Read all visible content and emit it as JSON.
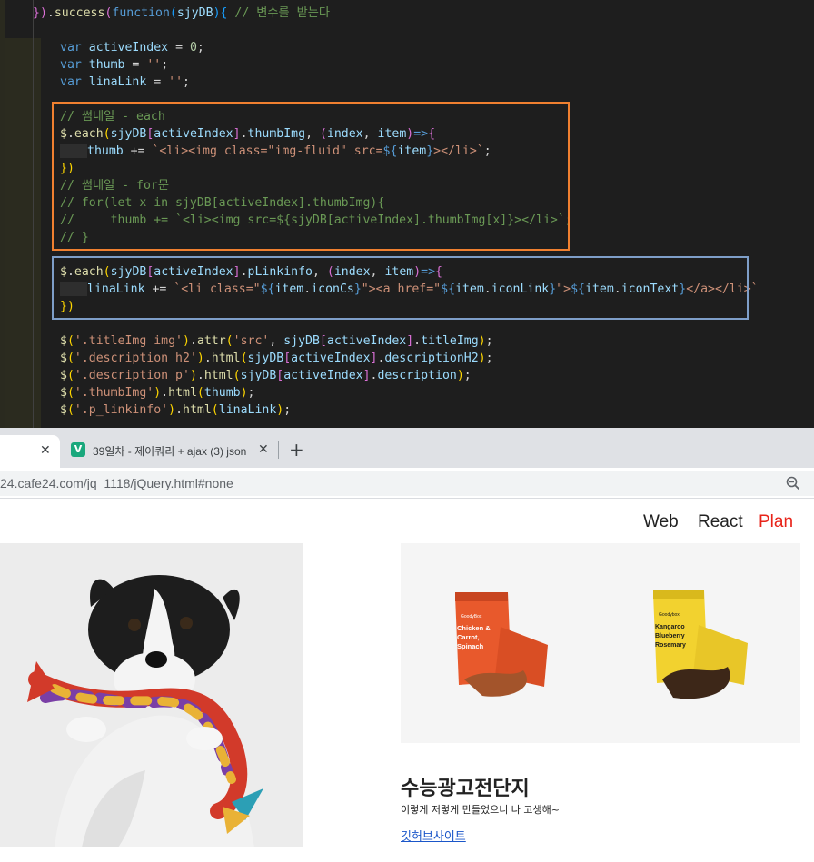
{
  "editor": {
    "lines": [
      [
        [
          "t-br2",
          "})"
        ],
        [
          "t-op",
          "."
        ],
        [
          "t-fn",
          "success"
        ],
        [
          "t-br2",
          "("
        ],
        [
          "t-kw",
          "function"
        ],
        [
          "t-br3",
          "("
        ],
        [
          "t-var",
          "sjyDB"
        ],
        [
          "t-br3",
          ")"
        ],
        [
          "t-br3",
          "{"
        ],
        [
          "t-op",
          " "
        ],
        [
          "t-cm",
          "// 변수를 받는다"
        ]
      ],
      [],
      [
        [
          "t-kw",
          "var"
        ],
        [
          "t-op",
          " "
        ],
        [
          "t-var",
          "activeIndex"
        ],
        [
          "t-op",
          " = "
        ],
        [
          "t-num",
          "0"
        ],
        [
          "t-op",
          ";"
        ]
      ],
      [
        [
          "t-kw",
          "var"
        ],
        [
          "t-op",
          " "
        ],
        [
          "t-var",
          "thumb"
        ],
        [
          "t-op",
          " = "
        ],
        [
          "t-str",
          "''"
        ],
        [
          "t-op",
          ";"
        ]
      ],
      [
        [
          "t-kw",
          "var"
        ],
        [
          "t-op",
          " "
        ],
        [
          "t-var",
          "linaLink"
        ],
        [
          "t-op",
          " = "
        ],
        [
          "t-str",
          "''"
        ],
        [
          "t-op",
          ";"
        ]
      ],
      [],
      [
        [
          "t-cm",
          "// 썸네일 - each"
        ]
      ],
      [
        [
          "t-fn",
          "$"
        ],
        [
          "t-op",
          "."
        ],
        [
          "t-fn",
          "each"
        ],
        [
          "t-br1",
          "("
        ],
        [
          "t-var",
          "sjyDB"
        ],
        [
          "t-br2",
          "["
        ],
        [
          "t-var",
          "activeIndex"
        ],
        [
          "t-br2",
          "]"
        ],
        [
          "t-op",
          "."
        ],
        [
          "t-var",
          "thumbImg"
        ],
        [
          "t-op",
          ", "
        ],
        [
          "t-br2",
          "("
        ],
        [
          "t-var",
          "index"
        ],
        [
          "t-op",
          ", "
        ],
        [
          "t-var",
          "item"
        ],
        [
          "t-br2",
          ")"
        ],
        [
          "t-kw",
          "=>"
        ],
        [
          "t-br2",
          "{"
        ]
      ],
      [
        [
          "ws",
          ""
        ],
        [
          "t-var",
          "thumb"
        ],
        [
          "t-op",
          " += "
        ],
        [
          "t-str",
          "`<li><img class=\"img-fluid\" src="
        ],
        [
          "t-tpl",
          "${"
        ],
        [
          "t-var",
          "item"
        ],
        [
          "t-tpl",
          "}"
        ],
        [
          "t-str",
          "></li>`"
        ],
        [
          "t-op",
          ";"
        ]
      ],
      [
        [
          "t-br1",
          "})"
        ]
      ],
      [
        [
          "t-cm",
          "// 썸네일 - for문"
        ]
      ],
      [
        [
          "t-cm",
          "// for(let x in sjyDB[activeIndex].thumbImg){"
        ]
      ],
      [
        [
          "t-cm",
          "//     thumb += `<li><img src=${sjyDB[activeIndex].thumbImg[x]}></li>`;"
        ]
      ],
      [
        [
          "t-cm",
          "// }"
        ]
      ],
      [],
      [
        [
          "t-fn",
          "$"
        ],
        [
          "t-op",
          "."
        ],
        [
          "t-fn",
          "each"
        ],
        [
          "t-br1",
          "("
        ],
        [
          "t-var",
          "sjyDB"
        ],
        [
          "t-br2",
          "["
        ],
        [
          "t-var",
          "activeIndex"
        ],
        [
          "t-br2",
          "]"
        ],
        [
          "t-op",
          "."
        ],
        [
          "t-var",
          "pLinkinfo"
        ],
        [
          "t-op",
          ", "
        ],
        [
          "t-br2",
          "("
        ],
        [
          "t-var",
          "index"
        ],
        [
          "t-op",
          ", "
        ],
        [
          "t-var",
          "item"
        ],
        [
          "t-br2",
          ")"
        ],
        [
          "t-kw",
          "=>"
        ],
        [
          "t-br2",
          "{"
        ]
      ],
      [
        [
          "ws",
          ""
        ],
        [
          "t-var",
          "linaLink"
        ],
        [
          "t-op",
          " += "
        ],
        [
          "t-str",
          "`<li class=\""
        ],
        [
          "t-tpl",
          "${"
        ],
        [
          "t-var",
          "item"
        ],
        [
          "t-op",
          "."
        ],
        [
          "t-var",
          "iconCs"
        ],
        [
          "t-tpl",
          "}"
        ],
        [
          "t-str",
          "\"><a href=\""
        ],
        [
          "t-tpl",
          "${"
        ],
        [
          "t-var",
          "item"
        ],
        [
          "t-op",
          "."
        ],
        [
          "t-var",
          "iconLink"
        ],
        [
          "t-tpl",
          "}"
        ],
        [
          "t-str",
          "\">"
        ],
        [
          "t-tpl",
          "${"
        ],
        [
          "t-var",
          "item"
        ],
        [
          "t-op",
          "."
        ],
        [
          "t-var",
          "iconText"
        ],
        [
          "t-tpl",
          "}"
        ],
        [
          "t-str",
          "</a></li>`"
        ]
      ],
      [
        [
          "t-br1",
          "})"
        ]
      ],
      [],
      [
        [
          "t-fn",
          "$"
        ],
        [
          "t-br1",
          "("
        ],
        [
          "t-str",
          "'.titleImg img'"
        ],
        [
          "t-br1",
          ")"
        ],
        [
          "t-op",
          "."
        ],
        [
          "t-fn",
          "attr"
        ],
        [
          "t-br1",
          "("
        ],
        [
          "t-str",
          "'src'"
        ],
        [
          "t-op",
          ", "
        ],
        [
          "t-var",
          "sjyDB"
        ],
        [
          "t-br2",
          "["
        ],
        [
          "t-var",
          "activeIndex"
        ],
        [
          "t-br2",
          "]"
        ],
        [
          "t-op",
          "."
        ],
        [
          "t-var",
          "titleImg"
        ],
        [
          "t-br1",
          ")"
        ],
        [
          "t-op",
          ";"
        ]
      ],
      [
        [
          "t-fn",
          "$"
        ],
        [
          "t-br1",
          "("
        ],
        [
          "t-str",
          "'.description h2'"
        ],
        [
          "t-br1",
          ")"
        ],
        [
          "t-op",
          "."
        ],
        [
          "t-fn",
          "html"
        ],
        [
          "t-br1",
          "("
        ],
        [
          "t-var",
          "sjyDB"
        ],
        [
          "t-br2",
          "["
        ],
        [
          "t-var",
          "activeIndex"
        ],
        [
          "t-br2",
          "]"
        ],
        [
          "t-op",
          "."
        ],
        [
          "t-var",
          "descriptionH2"
        ],
        [
          "t-br1",
          ")"
        ],
        [
          "t-op",
          ";"
        ]
      ],
      [
        [
          "t-fn",
          "$"
        ],
        [
          "t-br1",
          "("
        ],
        [
          "t-str",
          "'.description p'"
        ],
        [
          "t-br1",
          ")"
        ],
        [
          "t-op",
          "."
        ],
        [
          "t-fn",
          "html"
        ],
        [
          "t-br1",
          "("
        ],
        [
          "t-var",
          "sjyDB"
        ],
        [
          "t-br2",
          "["
        ],
        [
          "t-var",
          "activeIndex"
        ],
        [
          "t-br2",
          "]"
        ],
        [
          "t-op",
          "."
        ],
        [
          "t-var",
          "description"
        ],
        [
          "t-br1",
          ")"
        ],
        [
          "t-op",
          ";"
        ]
      ],
      [
        [
          "t-fn",
          "$"
        ],
        [
          "t-br1",
          "("
        ],
        [
          "t-str",
          "'.thumbImg'"
        ],
        [
          "t-br1",
          ")"
        ],
        [
          "t-op",
          "."
        ],
        [
          "t-fn",
          "html"
        ],
        [
          "t-br1",
          "("
        ],
        [
          "t-var",
          "thumb"
        ],
        [
          "t-br1",
          ")"
        ],
        [
          "t-op",
          ";"
        ]
      ],
      [
        [
          "t-fn",
          "$"
        ],
        [
          "t-br1",
          "("
        ],
        [
          "t-str",
          "'.p_linkinfo'"
        ],
        [
          "t-br1",
          ")"
        ],
        [
          "t-op",
          "."
        ],
        [
          "t-fn",
          "html"
        ],
        [
          "t-br1",
          "("
        ],
        [
          "t-var",
          "linaLink"
        ],
        [
          "t-br1",
          ")"
        ],
        [
          "t-op",
          ";"
        ]
      ]
    ]
  },
  "browser": {
    "tab2_title": "39일차 - 제이쿼리 + ajax (3) json",
    "tab2_favicon": "V",
    "url": "24.cafe24.com/jq_1118/jQuery.html#none",
    "close_glyph": "✕",
    "new_tab_glyph": "+"
  },
  "page": {
    "nav": [
      "Web",
      "React",
      "Plan"
    ],
    "products": [
      {
        "brand": "GoodyBox",
        "lines": [
          "Chicken &",
          "Carrot,",
          "Spinach"
        ],
        "bag": "#e8592c",
        "label": "#ffffff"
      },
      {
        "brand": "Goodybox",
        "lines": [
          "Kangaroo",
          "Blueberry",
          "Rosemary"
        ],
        "bag": "#f2d22f",
        "label": "#1a1a1a"
      }
    ],
    "title": "수능광고전단지",
    "desc": "이렇게 저렇게 만들었으니 나 고생해~",
    "link": "깃허브사이트"
  },
  "colors": {
    "editor_bg": "#1e1e1e",
    "orange_box": "#f08030",
    "blue_box": "#7e9ec8",
    "plan_red": "#e8241a",
    "link_blue": "#1a56c9"
  }
}
